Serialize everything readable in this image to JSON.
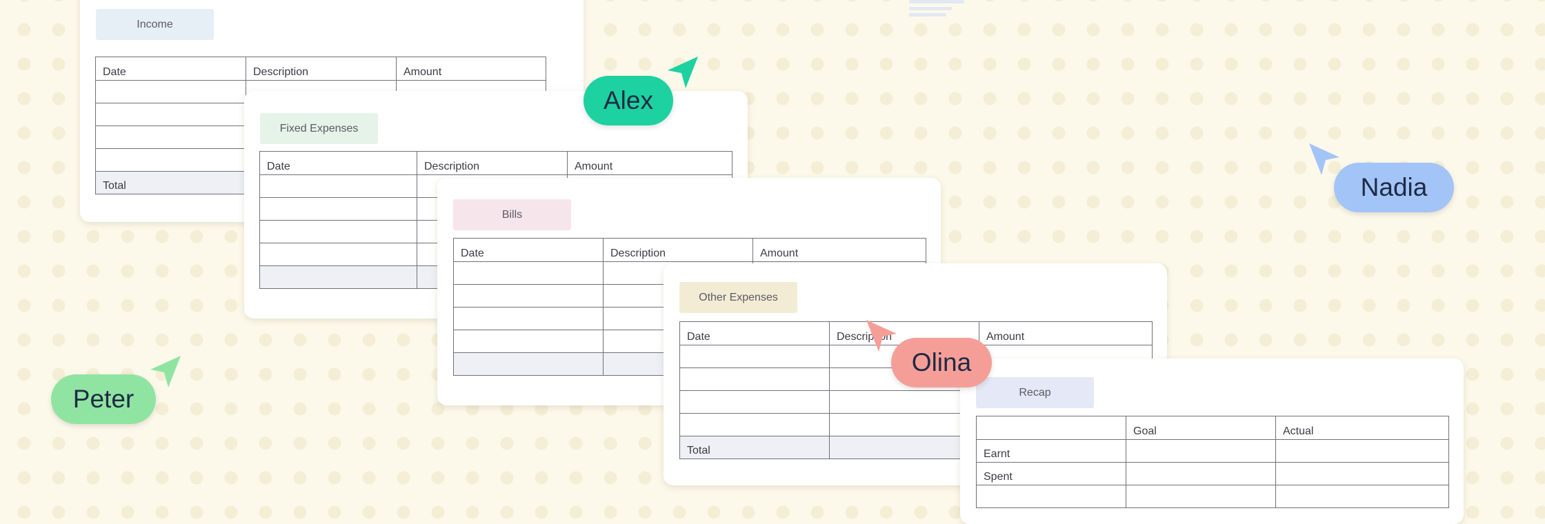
{
  "colors": {
    "background": "#fdf9ea",
    "income_tag": "#e6eef6",
    "fixed_tag": "#e6f3e9",
    "bills_tag": "#f6e6ec",
    "other_tag": "#f3ecd4",
    "recap_tag": "#e5e8f6",
    "alex": "#1dd1a1",
    "peter": "#90e4a2",
    "olina": "#f59e97",
    "nadia": "#a3c4f7"
  },
  "cards": {
    "income": {
      "tag": "Income",
      "columns": [
        "Date",
        "Description",
        "Amount"
      ],
      "total_label": "Total"
    },
    "fixed": {
      "tag": "Fixed Expenses",
      "columns": [
        "Date",
        "Description",
        "Amount"
      ]
    },
    "bills": {
      "tag": "Bills",
      "columns": [
        "Date",
        "Description",
        "Amount"
      ]
    },
    "other": {
      "tag": "Other Expenses",
      "columns": [
        "Date",
        "Description",
        "Amount"
      ],
      "total_label": "Total"
    },
    "recap": {
      "tag": "Recap",
      "columns": [
        "",
        "Goal",
        "Actual"
      ],
      "rows": [
        "Earnt",
        "Spent"
      ]
    }
  },
  "collaborators": {
    "alex": "Alex",
    "peter": "Peter",
    "olina": "Olina",
    "nadia": "Nadia"
  },
  "icons": {
    "cursor": "pointer-arrow-icon",
    "logo": "menu-lines-icon"
  }
}
